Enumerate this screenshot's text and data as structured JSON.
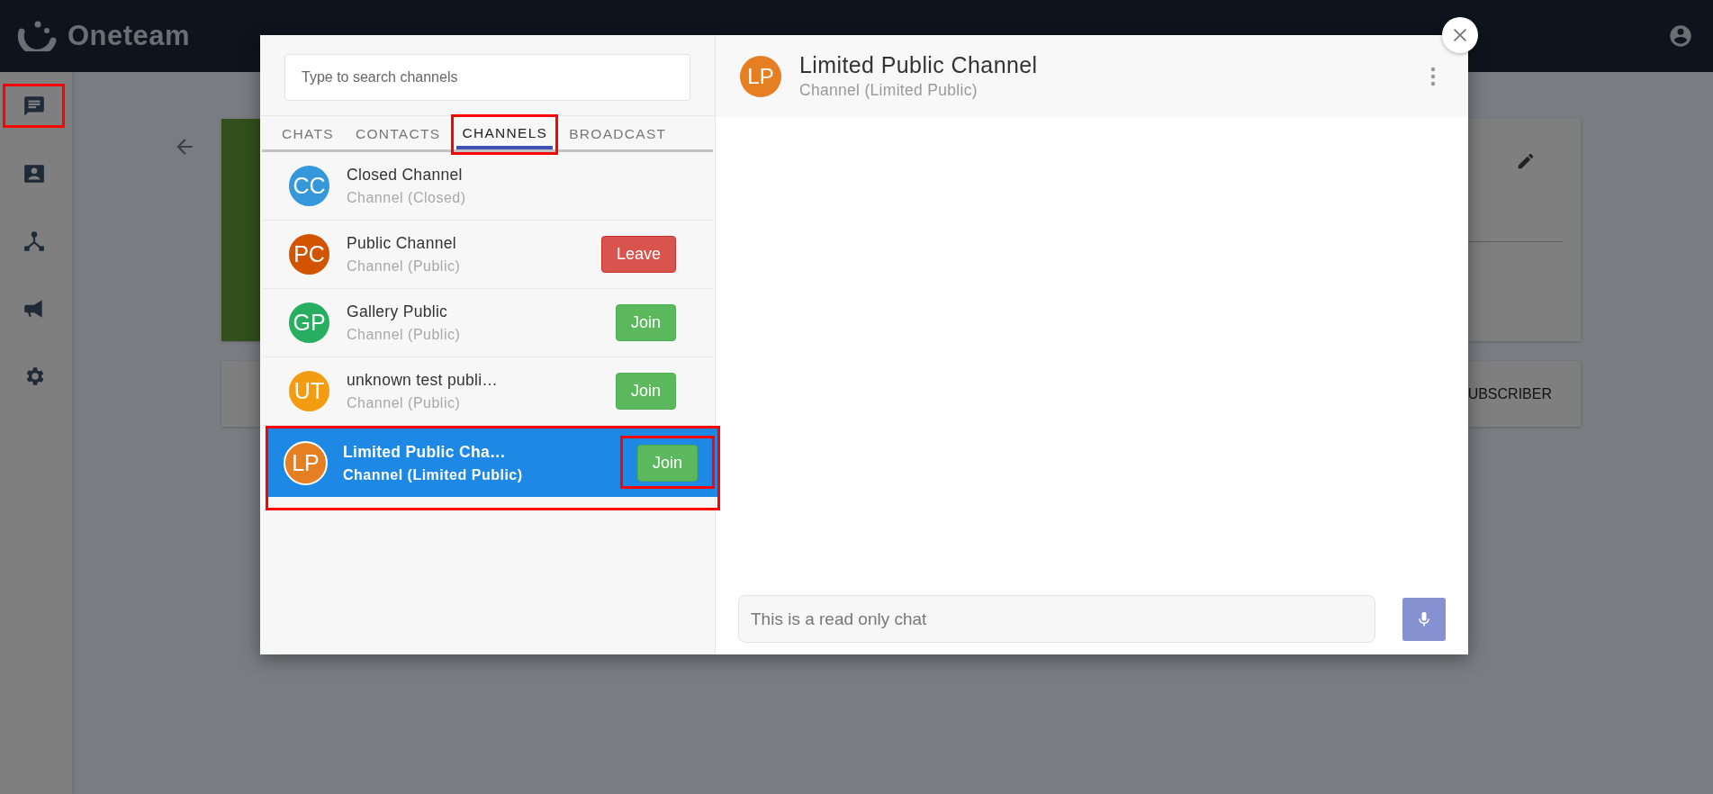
{
  "app": {
    "name": "Oneteam"
  },
  "nav": [
    {
      "kind": "chat",
      "annotated": true
    },
    {
      "kind": "contacts",
      "annotated": false
    },
    {
      "kind": "hub",
      "annotated": false
    },
    {
      "kind": "broadcast",
      "annotated": false
    },
    {
      "kind": "settings",
      "annotated": false
    }
  ],
  "background": {
    "card_action": "UBSCRIBER"
  },
  "dialog": {
    "search": {
      "placeholder": "Type to search channels"
    },
    "tabs": [
      {
        "label": "CHATS",
        "selected": false,
        "annotated": false
      },
      {
        "label": "CONTACTS",
        "selected": false,
        "annotated": false
      },
      {
        "label": "CHANNELS",
        "selected": true,
        "annotated": true
      },
      {
        "label": "BROADCAST",
        "selected": false,
        "annotated": false
      }
    ],
    "channels": [
      {
        "initials": "CC",
        "color": "#3498db",
        "name": "Closed Channel",
        "subtitle": "Channel (Closed)",
        "selected": false,
        "annotated": false
      },
      {
        "initials": "PC",
        "color": "#d35400",
        "name": "Public Channel",
        "subtitle": "Channel (Public)",
        "selected": false,
        "annotated": false,
        "action": {
          "kind": "leave",
          "label": "Leave",
          "annotated": false
        }
      },
      {
        "initials": "GP",
        "color": "#27ae60",
        "name": "Gallery Public",
        "subtitle": "Channel (Public)",
        "selected": false,
        "annotated": false,
        "action": {
          "kind": "join",
          "label": "Join",
          "annotated": false
        }
      },
      {
        "initials": "UT",
        "color": "#f39c12",
        "name": "unknown test publi…",
        "subtitle": "Channel (Public)",
        "selected": false,
        "annotated": false,
        "action": {
          "kind": "join",
          "label": "Join",
          "annotated": false
        }
      },
      {
        "initials": "LP",
        "color": "#e67e22",
        "name": "Limited Public Cha…",
        "subtitle": "Channel (Limited Public)",
        "selected": true,
        "annotated": true,
        "action": {
          "kind": "join",
          "label": "Join",
          "annotated": true
        }
      }
    ]
  },
  "conversation": {
    "initials": "LP",
    "color": "#e67e22",
    "title": "Limited Public Channel",
    "subtitle": "Channel (Limited Public)"
  },
  "composer": {
    "placeholder": "This is a read only chat",
    "disabled": true
  }
}
